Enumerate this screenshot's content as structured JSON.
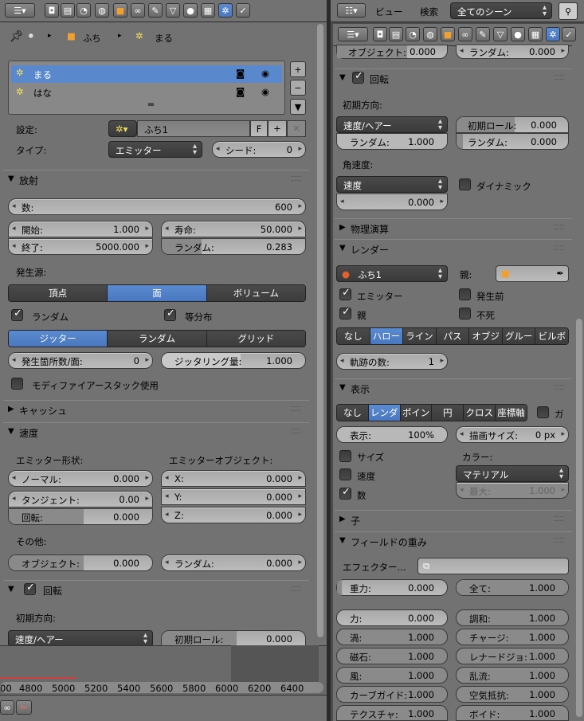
{
  "left_header": {
    "editor_icon": "properties-editor-icon"
  },
  "breadcrumb": {
    "item1": "ふち",
    "item2": "まる"
  },
  "particle_list": [
    "まる",
    "はな"
  ],
  "settings": {
    "label": "設定:",
    "value": "ふち1",
    "f": "F",
    "type_label": "タイプ:",
    "type_value": "エミッター",
    "seed_label": "シード:",
    "seed_value": "0"
  },
  "emission": {
    "title": "放射",
    "number_label": "数:",
    "number": "600",
    "start_label": "開始:",
    "start": "1.000",
    "end_label": "終了:",
    "end": "5000.000",
    "lifetime_label": "寿命:",
    "lifetime": "50.000",
    "random_label": "ランダム:",
    "random": "0.283",
    "source_label": "発生源:",
    "source_tabs": [
      "頂点",
      "面",
      "ボリューム"
    ],
    "random_check": "ランダム",
    "even_check": "等分布",
    "dist_tabs": [
      "ジッター",
      "ランダム",
      "グリッド"
    ],
    "per_face_label": "発生箇所数/面:",
    "per_face": "0",
    "jitter_label": "ジッタリング量:",
    "jitter": "1.000",
    "modifier_stack": "モディファイアースタック使用"
  },
  "cache": {
    "title": "キャッシュ"
  },
  "velocity": {
    "title": "速度",
    "emitter_geo": "エミッター形状:",
    "emitter_obj": "エミッターオブジェクト:",
    "normal_label": "ノーマル:",
    "normal": "0.000",
    "tangent_label": "タンジェント:",
    "tangent": "0.00",
    "rotation_label": "回転:",
    "rotation": "0.000",
    "x_label": "X:",
    "x": "0.000",
    "y_label": "Y:",
    "y": "0.000",
    "z_label": "Z:",
    "z": "0.000",
    "other": "その他:",
    "object_label": "オブジェクト:",
    "object": "0.000",
    "random_label": "ランダム:",
    "random": "0.000"
  },
  "rotation_left": {
    "title": "回転",
    "initial": "初期方向:",
    "dir": "速度/ヘアー",
    "phase_label": "初期ロール:",
    "phase": "0.000"
  },
  "timeline": {
    "ticks": [
      "00",
      "4800",
      "5000",
      "5200",
      "5400",
      "5600",
      "5800",
      "6000",
      "6200",
      "6400"
    ]
  },
  "right_header": {
    "view": "ビュー",
    "search": "検索",
    "scene": "全てのシーン"
  },
  "right_top": {
    "object_label": "オブジェクト:",
    "object": "0.000",
    "random_label": "ランダム:",
    "random": "0.000"
  },
  "rotation": {
    "title": "回転",
    "initial": "初期方向:",
    "dir": "速度/ヘアー",
    "random_label": "ランダム:",
    "random": "1.000",
    "phase_label": "初期ロール:",
    "phase": "0.000",
    "phase_random_label": "ランダム:",
    "phase_random": "0.000",
    "angular": "角速度:",
    "ang_mode": "速度",
    "ang_value": "0.000",
    "dynamic": "ダイナミック"
  },
  "physics": {
    "title": "物理演算"
  },
  "render": {
    "title": "レンダー",
    "material": "ふち1",
    "parent_label": "親:",
    "emitter": "エミッター",
    "parent": "親",
    "unborn": "発生前",
    "died": "不死",
    "tabs": [
      "なし",
      "ハロー",
      "ライン",
      "パス",
      "オブジ",
      "グルー",
      "ビルボ"
    ],
    "trail_label": "軌跡の数:",
    "trail": "1"
  },
  "display": {
    "title": "表示",
    "tabs": [
      "なし",
      "レンダ",
      "ポイン",
      "円",
      "クロス",
      "座標軸"
    ],
    "g": "ガ",
    "display_label": "表示:",
    "display": "100%",
    "size_label": "描画サイズ:",
    "size": "0 px",
    "size_check": "サイズ",
    "velocity_check": "速度",
    "number_check": "数",
    "color_label": "カラー:",
    "color_value": "マテリアル",
    "max_label": "最大:",
    "max": "1.000"
  },
  "children": {
    "title": "子"
  },
  "field_weights": {
    "title": "フィールドの重み",
    "effector_label": "エフェクター...",
    "gravity_label": "重力:",
    "gravity": "0.000",
    "all_label": "全て:",
    "all": "1.000",
    "force_label": "力:",
    "force": "0.000",
    "harmonic_label": "調和:",
    "harmonic": "1.000",
    "vortex_label": "渦:",
    "vortex": "1.000",
    "charge_label": "チャージ:",
    "charge": "1.000",
    "magnetic_label": "磁石:",
    "magnetic": "1.000",
    "lennard_label": "レナードジョ:",
    "lennard": "1.000",
    "wind_label": "風:",
    "wind": "1.000",
    "turbulence_label": "乱流:",
    "turbulence": "1.000",
    "curve_label": "カーブガイド:",
    "curve": "1.000",
    "drag_label": "空気抵抗:",
    "drag": "1.000",
    "texture_label": "テクスチャ:",
    "texture": "1.000",
    "boid_label": "ボイド:",
    "boid": "1.000"
  }
}
